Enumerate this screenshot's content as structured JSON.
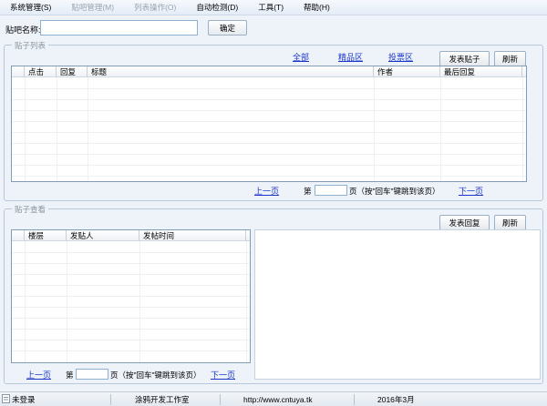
{
  "menu": [
    {
      "label": "系统管理(S)",
      "enabled": true
    },
    {
      "label": "贴吧管理(M)",
      "enabled": false
    },
    {
      "label": "列表操作(O)",
      "enabled": false
    },
    {
      "label": "自动检测(D)",
      "enabled": true
    },
    {
      "label": "工具(T)",
      "enabled": true
    },
    {
      "label": "帮助(H)",
      "enabled": true
    }
  ],
  "toolbar": {
    "name_label": "贴吧名称:",
    "name_value": "",
    "confirm_label": "确定"
  },
  "post_list": {
    "title": "贴子列表",
    "filters": [
      "全部",
      "精品区",
      "投票区"
    ],
    "publish_label": "发表贴子",
    "refresh_label": "刷新",
    "columns": [
      "点击",
      "回复",
      "标题",
      "作者",
      "最后回复"
    ],
    "pager": {
      "prev": "上一页",
      "page_prefix": "第",
      "page_suffix": "页（按\"回车\"键跳到该页）",
      "next": "下一页",
      "page_value": ""
    }
  },
  "post_view": {
    "title": "贴子查看",
    "reply_label": "发表回复",
    "refresh_label": "刷新",
    "columns": [
      "楼层",
      "发贴人",
      "发帖时间"
    ],
    "pager": {
      "prev": "上一页",
      "page_prefix": "第",
      "page_suffix": "页（按\"回车\"键跳到该页）",
      "next": "下一页",
      "page_value": ""
    }
  },
  "status": {
    "login": "未登录",
    "studio": "涂鸦开发工作室",
    "url": "http://www.cntuya.tk",
    "datetime": "2016年3月"
  }
}
